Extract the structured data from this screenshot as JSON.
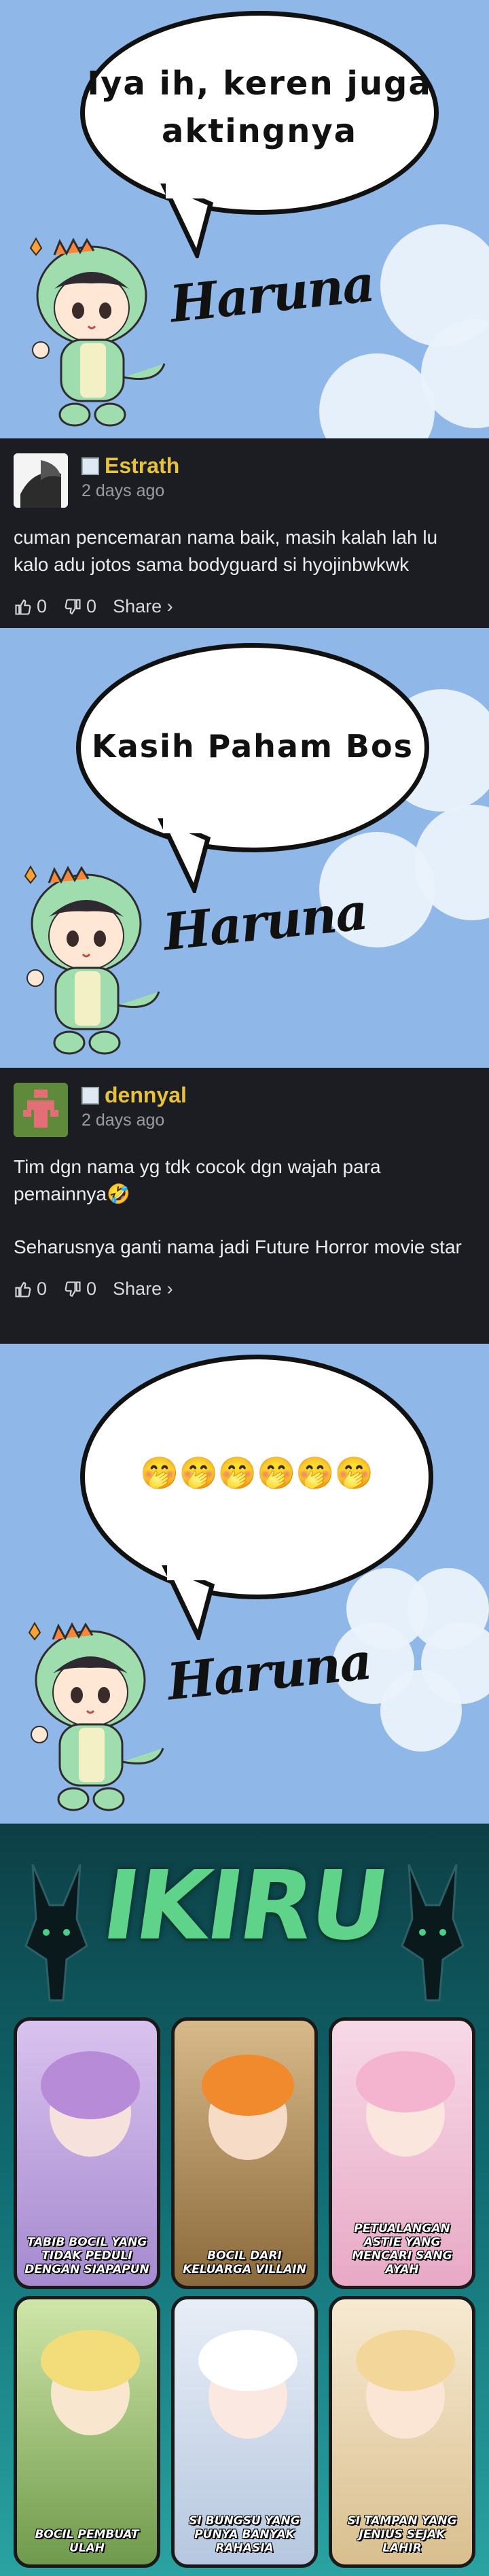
{
  "panels": [
    {
      "bubble_text_line1": "Iya ih, keren juga",
      "bubble_text_line2": "aktingnya",
      "signature": "Haruna"
    },
    {
      "bubble_text_line1": "Kasih Paham Bos",
      "signature": "Haruna"
    },
    {
      "bubble_text_line1": "🤭🤭🤭🤭🤭🤭",
      "signature": "Haruna"
    }
  ],
  "comments": [
    {
      "username": "Estrath",
      "time": "2 days ago",
      "text": "cuman pencemaran nama baik, masih kalah lah lu kalo adu jotos sama bodyguard si hyojinbwkwk",
      "likes": "0",
      "dislikes": "0",
      "share": "Share ›"
    },
    {
      "username": "dennyal",
      "time": "2 days ago",
      "text_line1": "Tim dgn nama yg tdk cocok dgn wajah para pemainnya🤣",
      "text_line2": "Seharusnya ganti nama jadi Future Horror movie star",
      "likes": "0",
      "dislikes": "0",
      "share": "Share ›"
    }
  ],
  "banner": {
    "title": "IKIRU",
    "cards": [
      {
        "caption": "TABIB BOCIL YANG TIDAK PEDULI DENGAN SIAPAPUN",
        "palette": "purple"
      },
      {
        "caption": "BOCIL DARI KELUARGA VILLAIN",
        "palette": "orange"
      },
      {
        "caption": "PETUALANGAN ASTIE YANG MENCARI SANG AYAH",
        "palette": "pink"
      },
      {
        "caption": "BOCIL PEMBUAT ULAH",
        "palette": "yellow"
      },
      {
        "caption": "SI BUNGSU YANG PUNYA BANYAK RAHASIA",
        "palette": "white"
      },
      {
        "caption": "SI TAMPAN YANG JENIUS SEJAK LAHIR",
        "palette": "cream"
      }
    ]
  }
}
